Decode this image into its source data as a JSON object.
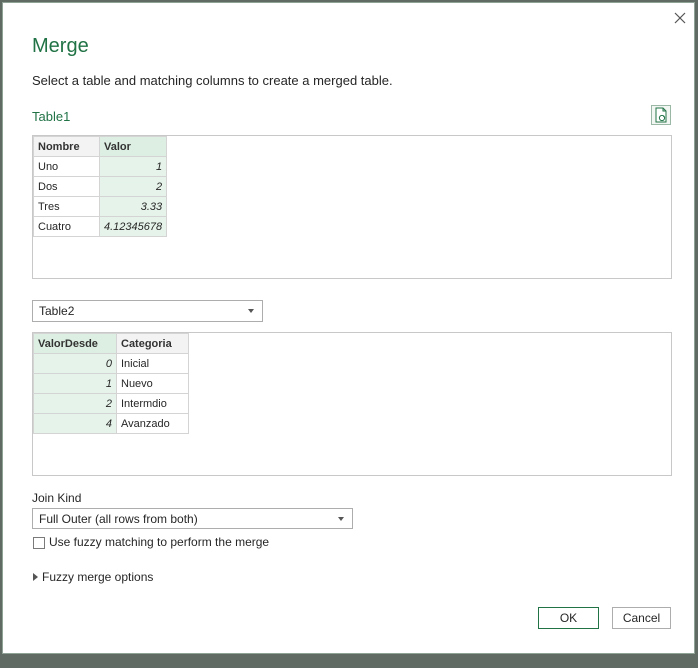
{
  "dialog": {
    "title": "Merge",
    "description": "Select a table and matching columns to create a merged table.",
    "close_icon": "close-icon"
  },
  "table1": {
    "label": "Table1",
    "refresh_icon": "refresh-preview-icon",
    "columns": [
      "Nombre",
      "Valor"
    ],
    "selected_column": "Valor",
    "rows": [
      [
        "Uno",
        "1"
      ],
      [
        "Dos",
        "2"
      ],
      [
        "Tres",
        "3.33"
      ],
      [
        "Cuatro",
        "4.12345678"
      ]
    ]
  },
  "table2": {
    "selected": "Table2",
    "columns": [
      "ValorDesde",
      "Categoria"
    ],
    "selected_column": "ValorDesde",
    "rows": [
      [
        "0",
        "Inicial"
      ],
      [
        "1",
        "Nuevo"
      ],
      [
        "2",
        "Intermdio"
      ],
      [
        "4",
        "Avanzado"
      ]
    ]
  },
  "join": {
    "label": "Join Kind",
    "selected": "Full Outer (all rows from both)"
  },
  "fuzzy": {
    "checkbox_label": "Use fuzzy matching to perform the merge",
    "checked": false,
    "options_label": "Fuzzy merge options"
  },
  "buttons": {
    "ok": "OK",
    "cancel": "Cancel"
  },
  "colors": {
    "accent": "#217346",
    "selected_column_bg": "#e6f3ea"
  }
}
